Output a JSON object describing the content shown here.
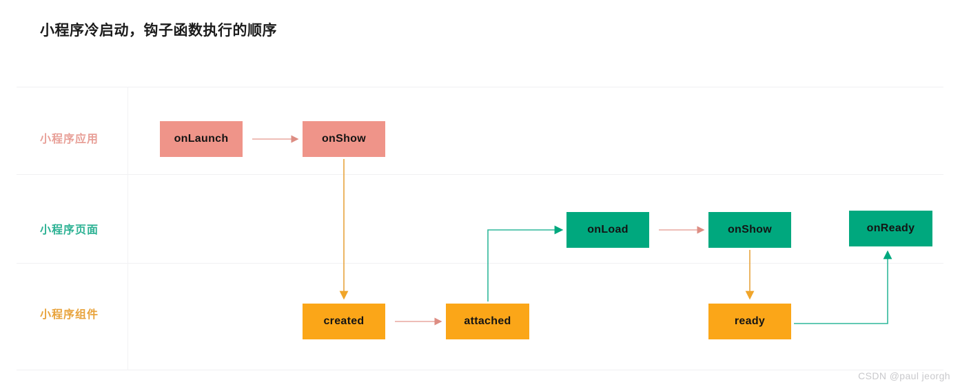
{
  "title": "小程序冷启动，钩子函数执行的顺序",
  "watermark": "CSDN @paul jeorgh",
  "colors": {
    "app_fill": "#ef9489",
    "app_label": "#e8a098",
    "page_fill": "#00a87e",
    "page_label": "#2bb193",
    "component_fill": "#fba618",
    "component_label": "#e8a33c",
    "arrow_salmon": "#e8a79f",
    "arrow_orange": "#e8a33c",
    "arrow_teal": "#2fb79a",
    "arrowhead_teal": "#00a87e",
    "grid_line": "#f0f0f2",
    "title_text": "#1b1b1b",
    "node_text": "#141414",
    "watermark_text": "#c9c9cc"
  },
  "rows": [
    {
      "label": "小程序应用"
    },
    {
      "label": "小程序页面"
    },
    {
      "label": "小程序组件"
    }
  ],
  "nodes": {
    "onlaunch": "onLaunch",
    "onshow_app": "onShow",
    "onload": "onLoad",
    "onshow_page": "onShow",
    "onready": "onReady",
    "created": "created",
    "attached": "attached",
    "ready": "ready"
  },
  "flow": [
    {
      "from": "onLaunch",
      "to": "onShow",
      "row": "小程序应用",
      "style": "horizontal",
      "color": "#e8a79f"
    },
    {
      "from": "onShow",
      "to": "created",
      "row": "小程序应用 → 小程序组件",
      "style": "vertical",
      "color": "#e8a33c"
    },
    {
      "from": "created",
      "to": "attached",
      "row": "小程序组件",
      "style": "horizontal",
      "color": "#e8a79f"
    },
    {
      "from": "attached",
      "to": "onLoad",
      "row": "小程序组件 → 小程序页面",
      "style": "elbow-up-right",
      "color": "#2fb79a"
    },
    {
      "from": "onLoad",
      "to": "onShow",
      "row": "小程序页面",
      "style": "horizontal",
      "color": "#e8a79f"
    },
    {
      "from": "onShow",
      "to": "ready",
      "row": "小程序页面 → 小程序组件",
      "style": "vertical",
      "color": "#e8a33c"
    },
    {
      "from": "ready",
      "to": "onReady",
      "row": "小程序组件 → 小程序页面",
      "style": "elbow-right-up",
      "color": "#2fb79a"
    }
  ]
}
